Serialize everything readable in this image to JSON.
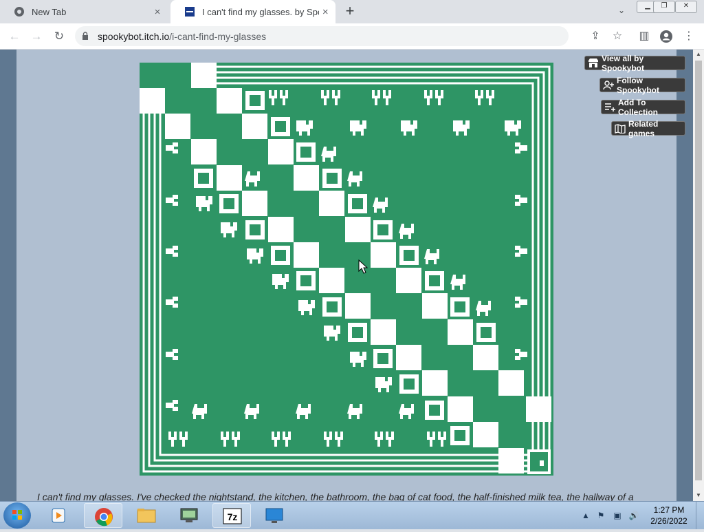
{
  "browser": {
    "tabs": [
      {
        "title": "New Tab",
        "active": false
      },
      {
        "title": "I can't find my glasses. by Spookybot",
        "active": true
      }
    ],
    "url_host": "spookybot.itch.io",
    "url_path": "/i-cant-find-my-glasses",
    "new_tab_symbol": "+",
    "close_symbol": "×"
  },
  "itch_buttons": {
    "view_all": "View all by Spookybot",
    "follow": "Follow Spookybot",
    "add_collection": "Add To Collection",
    "related": "Related games"
  },
  "page": {
    "description": "I can't find my glasses. I've checked the nightstand, the kitchen, the bathroom, the bag of cat food, the half-finished milk tea, the hallway of a"
  },
  "game_colors": {
    "green": "#2e9565",
    "white": "#ffffff"
  },
  "taskbar": {
    "time": "1:27 PM",
    "date": "2/26/2022",
    "apps": [
      "media-player-icon",
      "chrome-icon",
      "file-explorer-icon",
      "monitor-icon",
      "7zip-icon",
      "remote-desktop-icon"
    ]
  }
}
